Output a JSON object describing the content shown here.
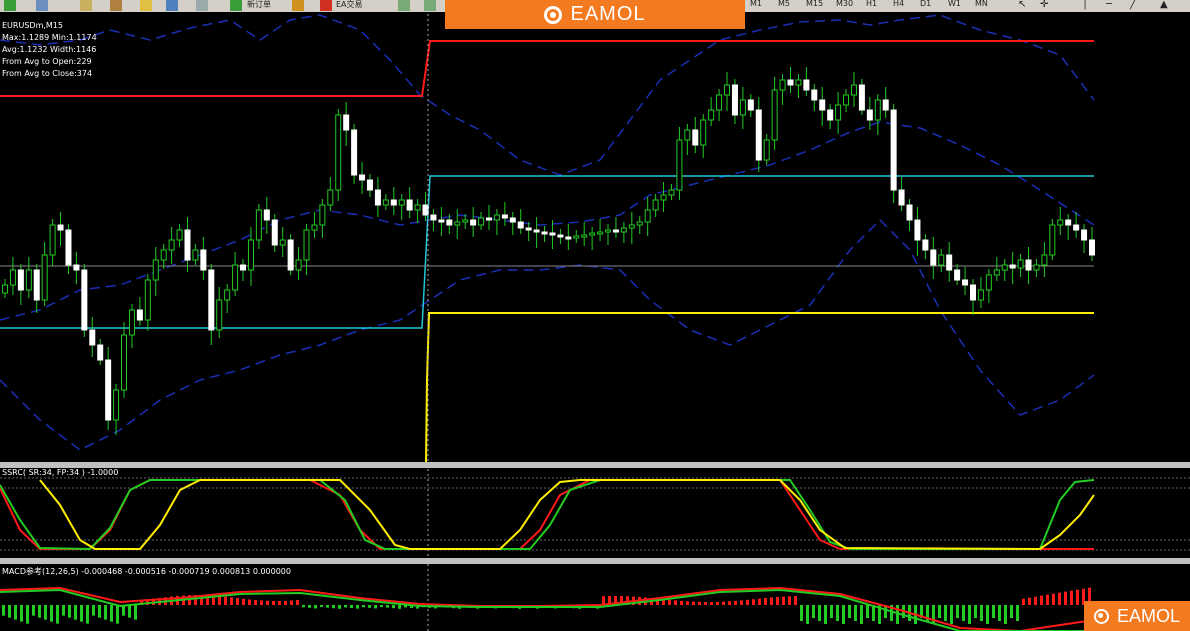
{
  "toolbar": {
    "text1": "新订单",
    "text2": "EA交易",
    "timeframes": [
      "M1",
      "M5",
      "M15",
      "M30",
      "H1",
      "H4",
      "D1",
      "W1",
      "MN"
    ]
  },
  "banner": {
    "logo_text": "EAMOL"
  },
  "corner_logo": {
    "logo_text": "EAMOL"
  },
  "main_chart": {
    "title": "EURUSDm,M15",
    "stats": [
      "Max:1.1289 Min:1.1174",
      "Avg:1.1232 Width:1146",
      "From Avg to Open:229",
      "From Avg to Close:374"
    ]
  },
  "ssrc_panel": {
    "label": "SSRC( SR:34, FP:34 ) -1.0000"
  },
  "macd_panel": {
    "label": "MACD参考(12,26,5) -0.000468 -0.000516 -0.000719 0.000813 0.000000"
  },
  "colors": {
    "bull": "#22cc22",
    "bear": "#ffffff",
    "band": "#1b2fb5",
    "red_level": "#ff1a1a",
    "yellow_level": "#ffee00",
    "cyan_level": "#22c8d8",
    "orange": "#f47a20"
  }
}
